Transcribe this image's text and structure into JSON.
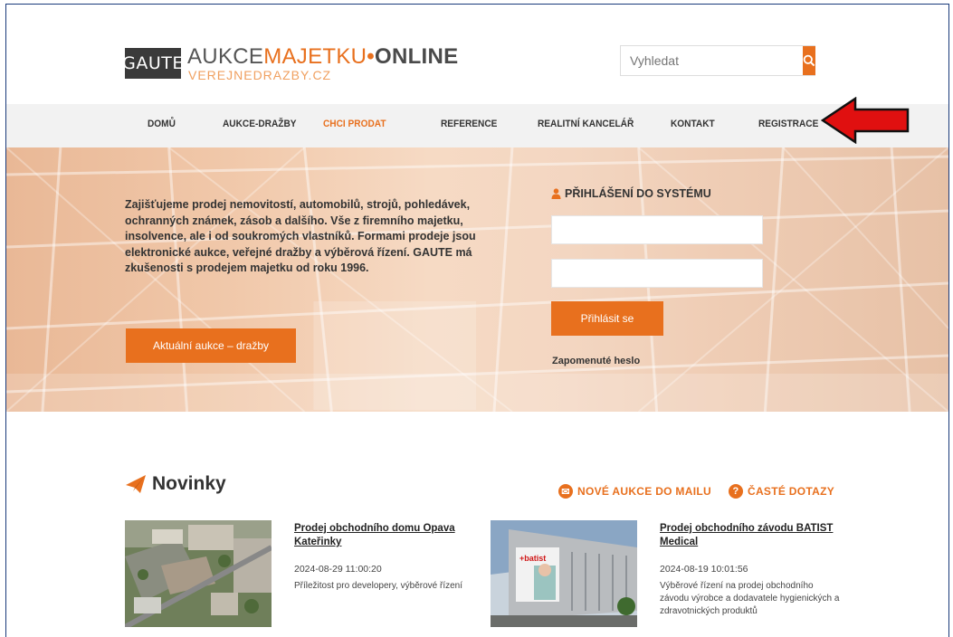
{
  "header": {
    "logo_box": "GAUTE",
    "logo_part1": "AUKCE",
    "logo_part2": "MAJETKU",
    "logo_dot": "•",
    "logo_part3": "ONLINE",
    "logo_sub": "VEREJNEDRAZBY.CZ",
    "search_placeholder": "Vyhledat",
    "search_icon": "search-icon"
  },
  "nav": {
    "items": [
      {
        "label": "DOMŮ"
      },
      {
        "label": "AUKCE-DRAŽBY"
      },
      {
        "label": "CHCI PRODAT"
      },
      {
        "label": "REFERENCE"
      },
      {
        "label": "REALITNÍ KANCELÁŘ"
      },
      {
        "label": "KONTAKT"
      },
      {
        "label": "REGISTRACE"
      }
    ],
    "active": "CHCI PRODAT"
  },
  "hero": {
    "text": "Zajišťujeme prodej nemovitostí, automobilů, strojů, pohledávek, ochranných známek, zásob a dalšího. Vše z firemního majetku, insolvence, ale i od soukromých vlastníků. Formami prodeje jsou elektronické aukce, veřejné dražby a výběrová řízení. GAUTE má zkušenosti s prodejem majetku od roku 1996.",
    "button_label": "Aktuální aukce – dražby"
  },
  "login": {
    "title": "PŘIHLÁŠENÍ DO SYSTÉMU",
    "username_value": "",
    "password_value": "",
    "button_label": "Přihlásit se",
    "forgot_label": "Zapomenuté heslo"
  },
  "news": {
    "title": "Novinky",
    "mail_link": "NOVÉ AUKCE DO MAILU",
    "faq_link": "ČASTÉ DOTAZY",
    "items": [
      {
        "title": "Prodej obchodního domu Opava Kateřinky",
        "date": "2024-08-29 11:00:20",
        "desc": "Příležitost pro developery, výběrové řízení"
      },
      {
        "title": "Prodej obchodního závodu BATIST Medical",
        "date": "2024-08-19 10:01:56",
        "desc": "Výběrové řízení na prodej obchodního závodu výrobce a dodavatele hygienických a zdravotnických produktů"
      }
    ]
  },
  "colors": {
    "accent": "#e8701e",
    "nav_bg": "#f2f2f2",
    "arrow": "#e01010"
  }
}
